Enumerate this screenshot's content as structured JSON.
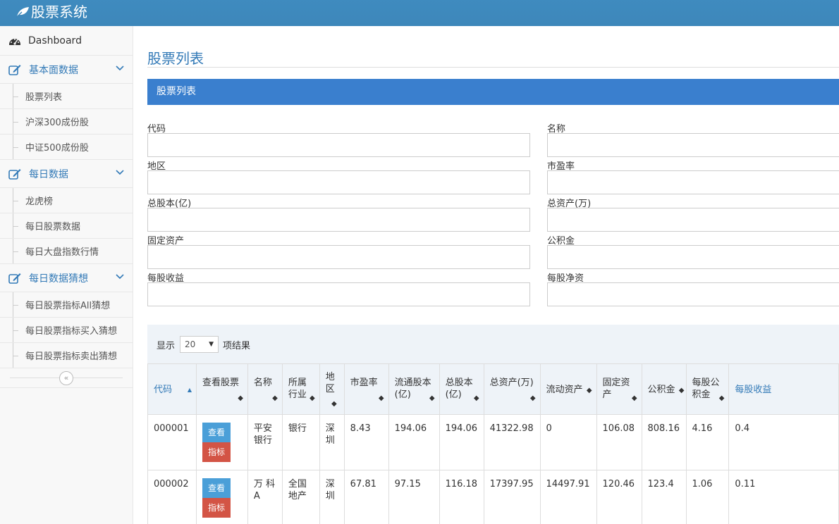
{
  "app": {
    "brand": "股票系统"
  },
  "sidebar": {
    "dashboard": "Dashboard",
    "groups": [
      {
        "label": "基本面数据",
        "items": [
          "股票列表",
          "沪深300成份股",
          "中证500成份股"
        ]
      },
      {
        "label": "每日数据",
        "items": [
          "龙虎榜",
          "每日股票数据",
          "每日大盘指数行情"
        ]
      },
      {
        "label": "每日数据猜想",
        "items": [
          "每日股票指标All猜想",
          "每日股票指标买入猜想",
          "每日股票指标卖出猜想"
        ]
      }
    ],
    "collapse_glyph": "«"
  },
  "main": {
    "page_title": "股票列表",
    "panel_title": "股票列表",
    "filters": [
      {
        "label": "代码",
        "value": ""
      },
      {
        "label": "名称",
        "value": ""
      },
      {
        "label": "地区",
        "value": ""
      },
      {
        "label": "市盈率",
        "value": ""
      },
      {
        "label": "总股本(亿)",
        "value": ""
      },
      {
        "label": "总资产(万)",
        "value": ""
      },
      {
        "label": "固定资产",
        "value": ""
      },
      {
        "label": "公积金",
        "value": ""
      },
      {
        "label": "每股收益",
        "value": ""
      },
      {
        "label": "每股净资",
        "value": ""
      }
    ],
    "length_prefix": "显示",
    "length_value": "20",
    "length_suffix": "项结果"
  },
  "table": {
    "columns": [
      "代码",
      "查看股票",
      "名称",
      "所属行业",
      "地区",
      "市盈率",
      "流通股本(亿)",
      "总股本(亿)",
      "总资产(万)",
      "流动资产",
      "固定资产",
      "公积金",
      "每股公积金",
      "每股收益"
    ],
    "rows": [
      {
        "code": "000001",
        "view_label": "查看",
        "indicator_label": "指标",
        "name": "平安银行",
        "industry": "银行",
        "area": "深圳",
        "pe": "8.43",
        "outstanding": "194.06",
        "totals": "194.06",
        "total_assets": "41322.98",
        "liquid_assets": "0",
        "fixed_assets": "106.08",
        "reserved": "808.16",
        "reserved_per_share": "4.16",
        "eps": "0.4"
      },
      {
        "code": "000002",
        "view_label": "查看",
        "indicator_label": "指标",
        "name": "万 科 A",
        "industry": "全国地产",
        "area": "深圳",
        "pe": "67.81",
        "outstanding": "97.15",
        "totals": "116.18",
        "total_assets": "17397.95",
        "liquid_assets": "14497.91",
        "fixed_assets": "120.46",
        "reserved": "123.4",
        "reserved_per_share": "1.06",
        "eps": "0.11"
      }
    ]
  },
  "colors": {
    "topbar": "#3d87ba",
    "accent": "#337ab7",
    "view_button": "#4a9fd8",
    "indicator_button": "#d35445"
  }
}
